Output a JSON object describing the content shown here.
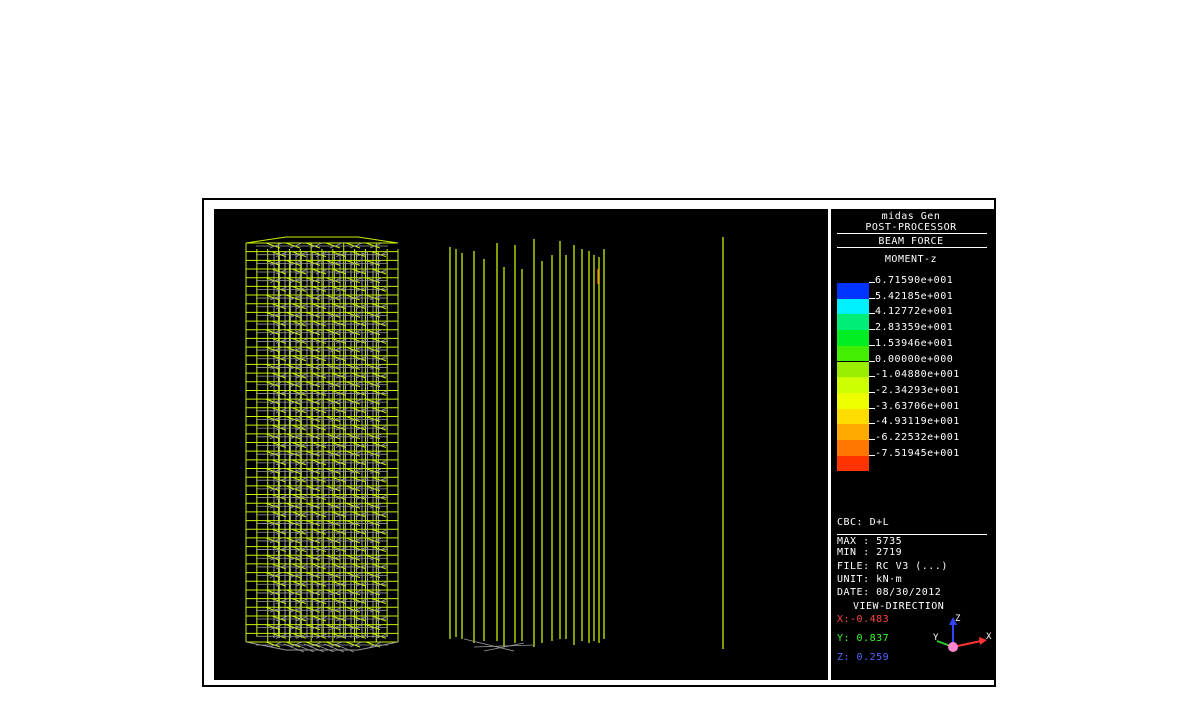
{
  "header": {
    "app_name": "midas Gen",
    "module": "POST-PROCESSOR",
    "result_type": "BEAM FORCE",
    "component": "MOMENT-z"
  },
  "legend": {
    "entries": [
      {
        "value": "6.71590e+001",
        "color": "#0033ff"
      },
      {
        "value": "5.42185e+001",
        "color": "#00f0ff"
      },
      {
        "value": "4.12772e+001",
        "color": "#00ee77"
      },
      {
        "value": "2.83359e+001",
        "color": "#00ee22"
      },
      {
        "value": "1.53946e+001",
        "color": "#44ee00"
      },
      {
        "value": "0.00000e+000",
        "color": "#99ee00"
      },
      {
        "value": "-1.04880e+001",
        "color": "#ccff00"
      },
      {
        "value": "-2.34293e+001",
        "color": "#eeff00"
      },
      {
        "value": "-3.63706e+001",
        "color": "#ffdd00"
      },
      {
        "value": "-4.93119e+001",
        "color": "#ffaa00"
      },
      {
        "value": "-6.22532e+001",
        "color": "#ff7700"
      },
      {
        "value": "-7.51945e+001",
        "color": "#ff3300"
      }
    ]
  },
  "info": {
    "cbc": "CBC: D+L",
    "max": "MAX : 5735",
    "min": "MIN : 2719",
    "file": "FILE: RC V3 (...)",
    "unit": "UNIT: kN·m",
    "date": "DATE: 08/30/2012",
    "view_direction_label": "VIEW-DIRECTION",
    "x": "X:-0.483",
    "y": "Y: 0.837",
    "z": "Z: 0.259"
  },
  "axis_labels": {
    "x": "X",
    "y": "Y",
    "z": "Z"
  },
  "colors": {
    "frame_lines": "#c8f000",
    "gray_lines": "#9a9a9a",
    "x_color": "#ff4444",
    "y_color": "#33ff33",
    "z_color": "#5566ff"
  }
}
